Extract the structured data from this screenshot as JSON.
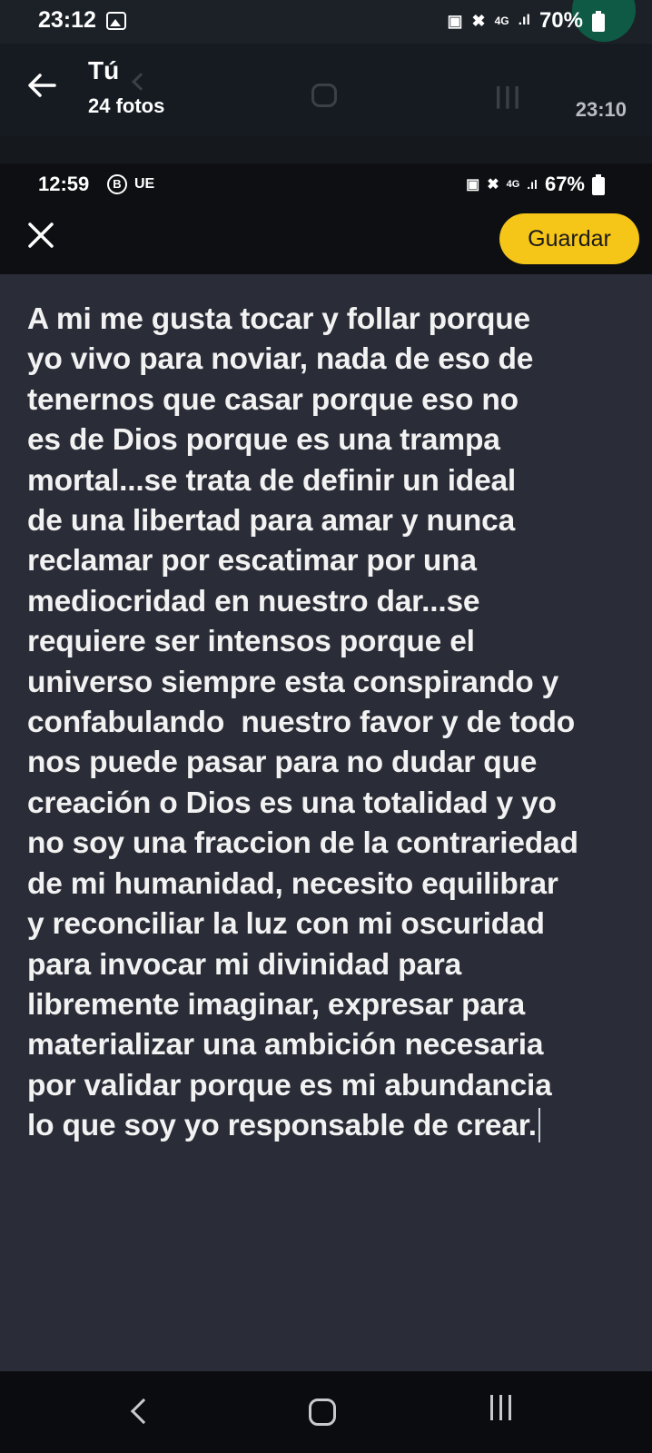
{
  "outer_status_bar": {
    "time": "23:12",
    "battery": "70%",
    "network": "4G"
  },
  "viewer_header": {
    "title": "Tú",
    "subtitle": "24 fotos",
    "timestamp": "23:10"
  },
  "inner_status_bar": {
    "time": "12:59",
    "carrier_badge": "B",
    "carrier": "UE",
    "battery": "67%",
    "network": "4G"
  },
  "editor": {
    "save_label": "Guardar",
    "accent_color": "#f5c518",
    "text": "A mi me gusta tocar y follar porque\nyo vivo para noviar, nada de eso de\ntenernos que casar porque eso no\nes de Dios porque es una trampa\nmortal...se trata de definir un ideal\nde una libertad para amar y nunca\nreclamar por escatimar por una\nmediocridad en nuestro dar...se\nrequiere ser intensos porque el\nuniverso siempre esta conspirando y\nconfabulando  nuestro favor y de todo\nnos puede pasar para no dudar que\ncreación o Dios es una totalidad y yo\nno soy una fraccion de la contrariedad\nde mi humanidad, necesito equilibrar\ny reconciliar la luz con mi oscuridad\npara invocar mi divinidad para\nlibremente imaginar, expresar para\nmaterializar una ambición necesaria\npor validar porque es mi abundancia\nlo que soy yo responsable de crear."
  },
  "icons": {
    "back": "arrow-left-icon",
    "close": "close-icon",
    "gallery": "image-icon",
    "nav_back": "chevron-left-icon",
    "nav_home": "home-icon",
    "nav_recents": "recents-icon"
  }
}
